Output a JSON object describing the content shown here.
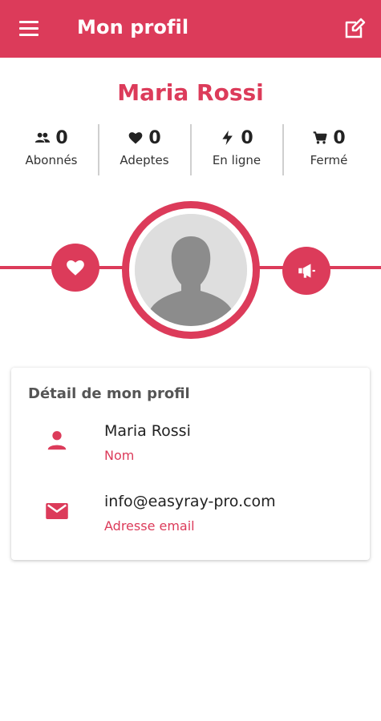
{
  "colors": {
    "accent": "#dc3b5a",
    "appbar": "#dc3b5a"
  },
  "appbar": {
    "title": "Mon profil",
    "menu_icon": "hamburger-menu-icon",
    "edit_icon": "edit-icon"
  },
  "profile": {
    "name": "Maria Rossi"
  },
  "stats": [
    {
      "icon": "people-icon",
      "count": "0",
      "label": "Abonnés"
    },
    {
      "icon": "heart-icon",
      "count": "0",
      "label": "Adeptes"
    },
    {
      "icon": "bolt-icon",
      "count": "0",
      "label": "En ligne"
    },
    {
      "icon": "cart-icon",
      "count": "0",
      "label": "Fermé"
    }
  ],
  "actions": {
    "left_icon": "heart-icon",
    "right_icon": "megaphone-icon",
    "avatar_icon": "default-avatar-icon"
  },
  "card": {
    "title": "Détail de mon profil",
    "rows": [
      {
        "icon": "person-icon",
        "value": "Maria Rossi",
        "label": "Nom"
      },
      {
        "icon": "mail-icon",
        "value": "info@easyray-pro.com",
        "label": "Adresse email"
      }
    ]
  }
}
